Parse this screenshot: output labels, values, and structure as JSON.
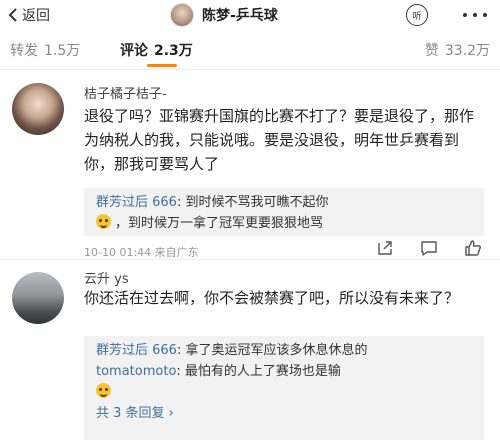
{
  "header": {
    "back_label": "返回",
    "title": "陈梦-乒乓球",
    "listen_label": "听"
  },
  "tabs": {
    "repost_label": "转发",
    "repost_count": "1.5万",
    "comment_label": "评论",
    "comment_count": "2.3万",
    "like_label": "赞",
    "like_count": "33.2万"
  },
  "comments": [
    {
      "username": "桔子橘子桔子-",
      "text": "退役了吗？亚锦赛升国旗的比赛不打了？要是退役了，那作为纳税人的我，只能说哦。要是没退役，明年世乒赛看到你，那我可要骂人了",
      "replies": [
        {
          "name": "群芳过后 666",
          "text": ": 到时候不骂我可瞧不起你"
        },
        {
          "name": "",
          "text": "，到时候万一拿了冠军更要狠狠地骂"
        }
      ],
      "time": "10-10 01:44",
      "location": "来自广东"
    },
    {
      "username": "云升 ys",
      "text": "你还活在过去啊，你不会被禁赛了吧，所以没有未来了？",
      "replies": [
        {
          "name": "群芳过后 666",
          "text": ": 拿了奥运冠军应该多休息休息的"
        },
        {
          "name": "tomatomoto",
          "text": ": 最怕有的人上了赛场也是输"
        }
      ],
      "more_replies": "共 3 条回复"
    }
  ],
  "colors": {
    "accent": "#ff8200",
    "link": "#3f6f9d",
    "reply_bg": "#f2f2f2"
  }
}
